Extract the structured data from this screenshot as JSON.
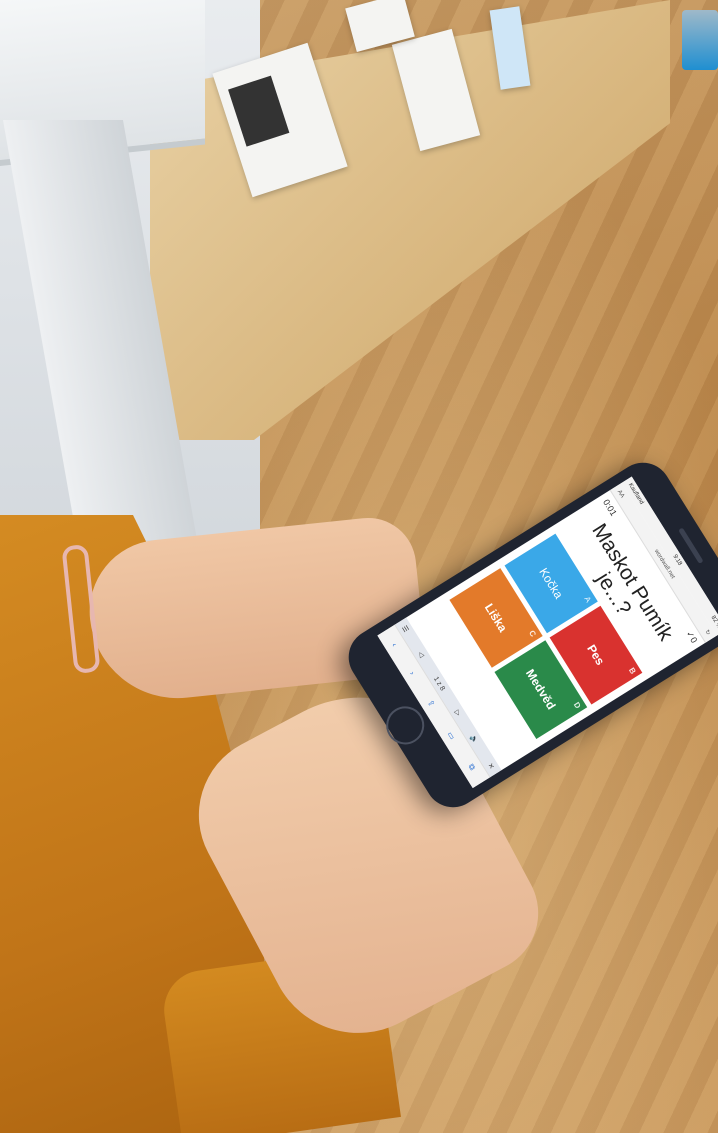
{
  "scene": {
    "description_tags": [
      "classroom-floor",
      "hands-holding-phone"
    ]
  },
  "phone": {
    "status": {
      "carrier": "Kaufland",
      "time": "9:18",
      "battery": "82 %"
    },
    "browser": {
      "text_size": "AA",
      "url": "wordwall.net",
      "reload_icon": "reload-icon"
    },
    "quiz": {
      "timer": "0:01",
      "score": "0",
      "question": "Maskot Pumík je...?",
      "options": [
        {
          "letter": "A",
          "label": "Kočka",
          "color": "#3aa8e8"
        },
        {
          "letter": "B",
          "label": "Pes",
          "color": "#d9322f"
        },
        {
          "letter": "C",
          "label": "Liška",
          "color": "#e37a2a"
        },
        {
          "letter": "D",
          "label": "Medvěd",
          "color": "#2a8a4a"
        }
      ],
      "page_indicator": "1 z 8"
    }
  }
}
